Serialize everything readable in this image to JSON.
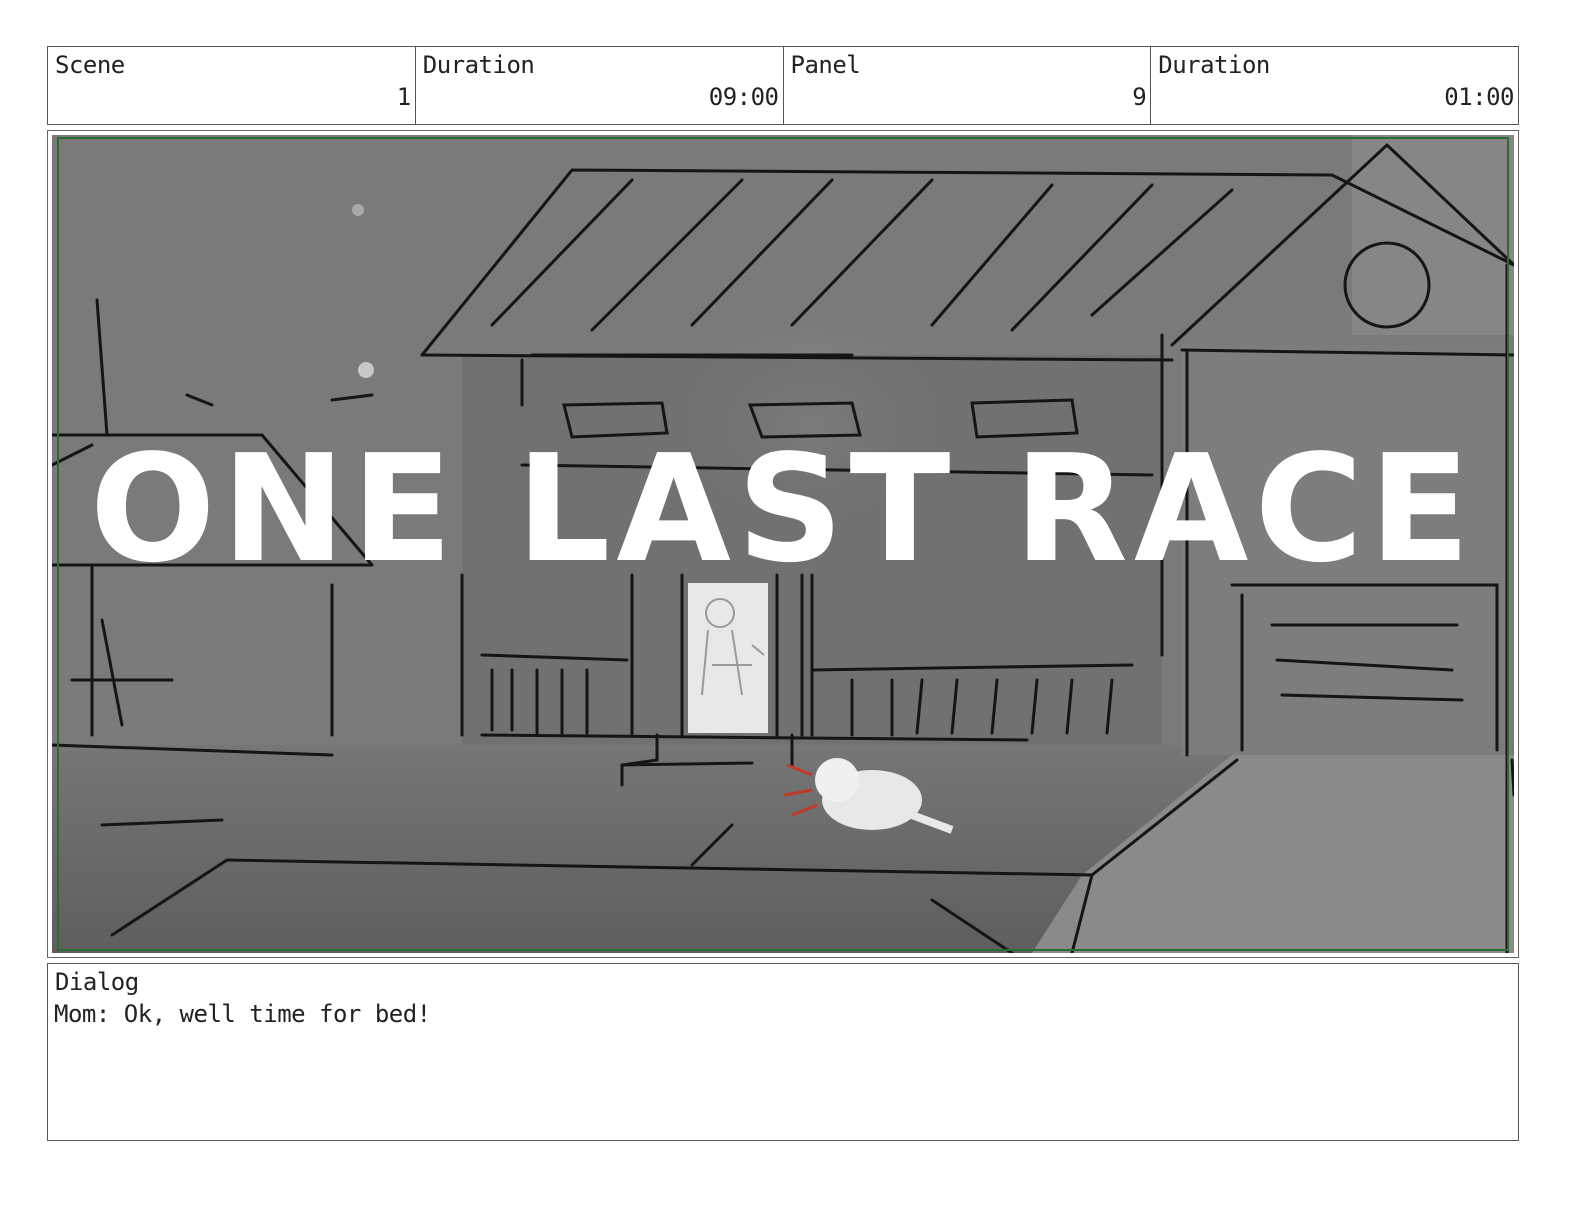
{
  "header": {
    "scene": {
      "label": "Scene",
      "value": "1"
    },
    "scene_duration": {
      "label": "Duration",
      "value": "09:00"
    },
    "panel": {
      "label": "Panel",
      "value": "9"
    },
    "panel_duration": {
      "label": "Duration",
      "value": "01:00"
    }
  },
  "panel_image": {
    "title_text": "ONE LAST RACE",
    "colors": {
      "background": "#7c7c7c",
      "safe_frame": "#2f6b2f",
      "sketch_line": "#151515",
      "title_text": "#ffffff",
      "accent_mark": "#c23a2a"
    }
  },
  "dialog": {
    "label": "Dialog",
    "text": "Mom: Ok, well time for bed!"
  }
}
